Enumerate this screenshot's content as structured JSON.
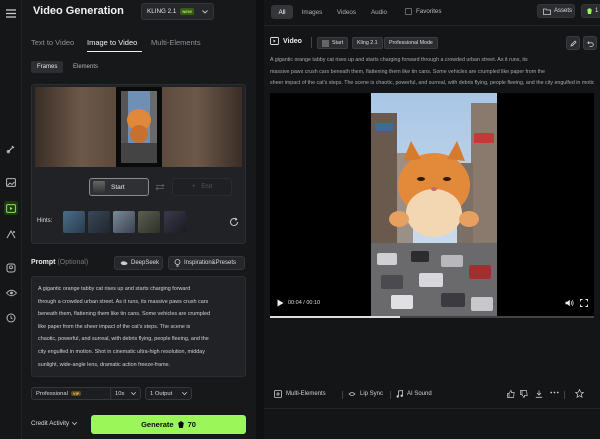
{
  "app": {
    "title": "Video Generation",
    "model": "KLING 2.1",
    "model_badge": "NEW"
  },
  "mode_tabs": [
    {
      "label": "Text to Video",
      "active": false
    },
    {
      "label": "Image to Video",
      "active": true
    },
    {
      "label": "Multi-Elements",
      "active": false
    }
  ],
  "sub_tabs": [
    {
      "label": "Frames",
      "active": true
    },
    {
      "label": "Elements",
      "active": false
    }
  ],
  "frames": {
    "start_label": "Start",
    "end_label": "End",
    "hints_label": "Hints:"
  },
  "prompt": {
    "label": "Prompt",
    "optional": "(Optional)",
    "deepseek": "DeepSeek",
    "inspiration": "Inspiration&Presets",
    "lines": [
      "A gigantic orange tabby cat rises up and starts charging forward",
      "through a crowded urban street. As it runs, its massive paws crush cars",
      "beneath them, flattening them like tin cans. Some vehicles are crumpled",
      "like paper from the sheer impact of the cat's steps. The scene is",
      "chaotic, powerful, and surreal, with debris flying, people fleeing, and the",
      "city engulfed in motion. Shot in cinematic ultra-high resolution, midday",
      "sunlight, wide-angle lens, dramatic action freeze-frame."
    ]
  },
  "settings": {
    "mode": "Professional",
    "vip_badge": "VIP",
    "duration": "10s",
    "outputs": "1 Output"
  },
  "footer": {
    "credit_activity": "Credit Activity",
    "generate_label": "Generate",
    "generate_cost": "70"
  },
  "filters": [
    {
      "label": "All",
      "active": true
    },
    {
      "label": "Images",
      "active": false
    },
    {
      "label": "Videos",
      "active": false
    },
    {
      "label": "Audio",
      "active": false
    }
  ],
  "favorites_label": "Favorites",
  "assets_label": "Assets",
  "header_count": "1",
  "video": {
    "section_label": "Video",
    "tags": [
      "Start",
      "Kling 2.1",
      "Professional Mode"
    ],
    "description_lines": [
      "A gigantic orange tabby cat rises up and starts charging forward through a crowded urban street. As it runs, its",
      "massive paws crush cars beneath them, flattening them like tin cans. Some vehicles are crumpled like paper from the",
      "sheer impact of the cat's steps. The scene is chaotic, powerful, and surreal, with debris flying, people fleeing, and the city engulfed in motion. Sh"
    ],
    "time": "00:04 / 00:10",
    "progress": 0.4
  },
  "video_actions": {
    "multi_elements": "Multi-Elements",
    "lip_sync": "Lip Sync",
    "ai_sound": "AI Sound"
  },
  "colors": {
    "accent": "#9bf65a",
    "rail_active": "#1f3a1a",
    "vip": "#f0c84e"
  }
}
